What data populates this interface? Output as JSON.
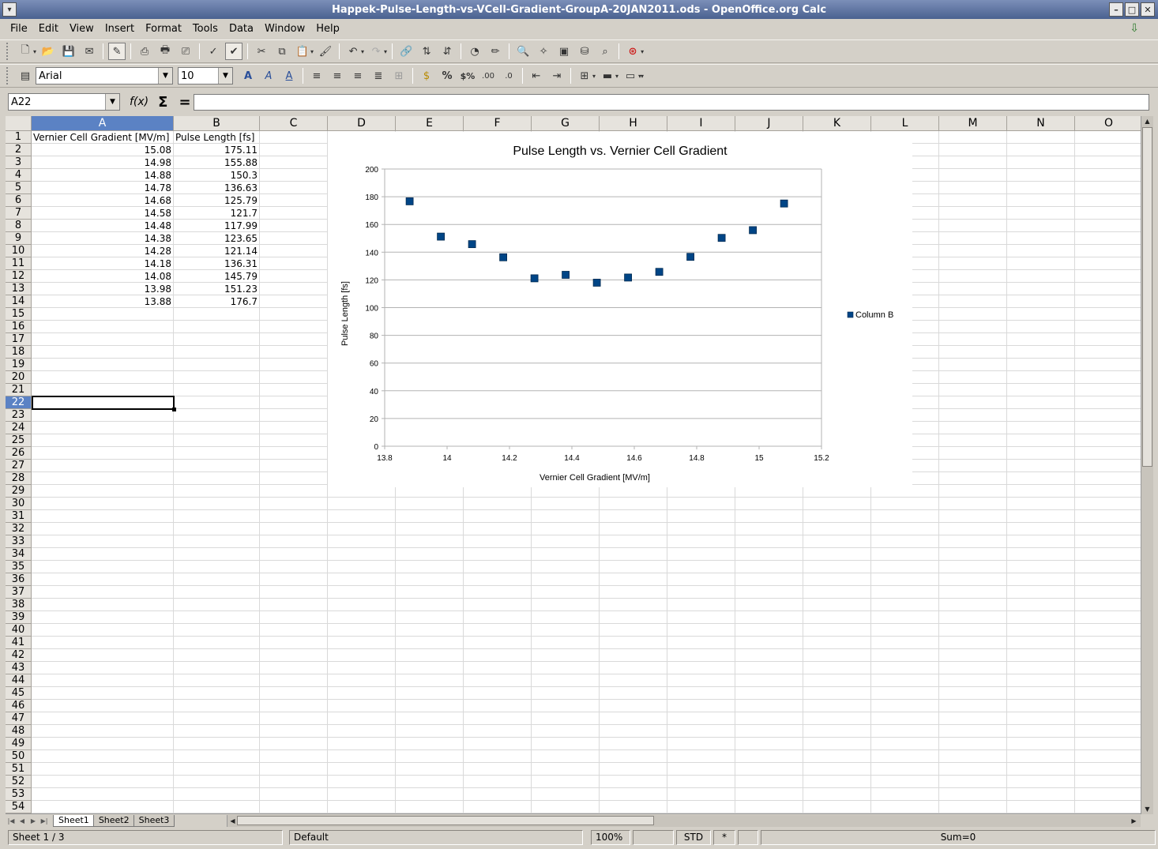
{
  "window": {
    "title": "Happek-Pulse-Length-vs-VCell-Gradient-GroupA-20JAN2011.ods - OpenOffice.org Calc"
  },
  "menu": [
    "File",
    "Edit",
    "View",
    "Insert",
    "Format",
    "Tools",
    "Data",
    "Window",
    "Help"
  ],
  "formatting": {
    "font_name": "Arial",
    "font_size": "10"
  },
  "formula_bar": {
    "cell_reference": "A22",
    "content": ""
  },
  "columns": [
    "A",
    "B",
    "C",
    "D",
    "E",
    "F",
    "G",
    "H",
    "I",
    "J",
    "K",
    "L",
    "M",
    "N",
    "O"
  ],
  "rows_visible": [
    "1",
    "2",
    "3",
    "4",
    "5",
    "6",
    "7",
    "8",
    "9",
    "10",
    "11",
    "12",
    "13",
    "14",
    "15",
    "16",
    "17",
    "18",
    "19",
    "20",
    "21",
    "22",
    "23",
    "24",
    "25",
    "26",
    "27",
    "28",
    "29",
    "30",
    "31",
    "32",
    "33",
    "34",
    "35",
    "36",
    "37",
    "38",
    "39",
    "40",
    "41",
    "42",
    "43",
    "44",
    "45",
    "46",
    "47",
    "48",
    "49",
    "50",
    "51",
    "52",
    "53",
    "54"
  ],
  "active_cell": {
    "column": "A",
    "row": "22"
  },
  "sheet": {
    "headers": [
      "Vernier Cell Gradient [MV/m]",
      "Pulse Length [fs]"
    ],
    "rows": [
      [
        "15.08",
        "175.11"
      ],
      [
        "14.98",
        "155.88"
      ],
      [
        "14.88",
        "150.3"
      ],
      [
        "14.78",
        "136.63"
      ],
      [
        "14.68",
        "125.79"
      ],
      [
        "14.58",
        "121.7"
      ],
      [
        "14.48",
        "117.99"
      ],
      [
        "14.38",
        "123.65"
      ],
      [
        "14.28",
        "121.14"
      ],
      [
        "14.18",
        "136.31"
      ],
      [
        "14.08",
        "145.79"
      ],
      [
        "13.98",
        "151.23"
      ],
      [
        "13.88",
        "176.7"
      ]
    ]
  },
  "chart_data": {
    "type": "scatter",
    "title": "Pulse Length vs. Vernier Cell Gradient",
    "xlabel": "Vernier Cell Gradient [MV/m]",
    "ylabel": "Pulse Length [fs]",
    "xlim": [
      13.8,
      15.2
    ],
    "ylim": [
      0,
      200
    ],
    "x_ticks": [
      "13.8",
      "14",
      "14.2",
      "14.4",
      "14.6",
      "14.8",
      "15",
      "15.2"
    ],
    "y_ticks": [
      "0",
      "20",
      "40",
      "60",
      "80",
      "100",
      "120",
      "140",
      "160",
      "180",
      "200"
    ],
    "grid": "horizontal",
    "legend": "right",
    "series": [
      {
        "name": "Column B",
        "color": "#004586",
        "x": [
          15.08,
          14.98,
          14.88,
          14.78,
          14.68,
          14.58,
          14.48,
          14.38,
          14.28,
          14.18,
          14.08,
          13.98,
          13.88
        ],
        "y": [
          175.11,
          155.88,
          150.3,
          136.63,
          125.79,
          121.7,
          117.99,
          123.65,
          121.14,
          136.31,
          145.79,
          151.23,
          176.7
        ]
      }
    ]
  },
  "sheet_tabs": [
    "Sheet1",
    "Sheet2",
    "Sheet3"
  ],
  "status": {
    "sheet_position": "Sheet 1 / 3",
    "page_style": "Default",
    "zoom": "100%",
    "selection_mode": "STD",
    "modified": "*",
    "sum": "Sum=0"
  }
}
